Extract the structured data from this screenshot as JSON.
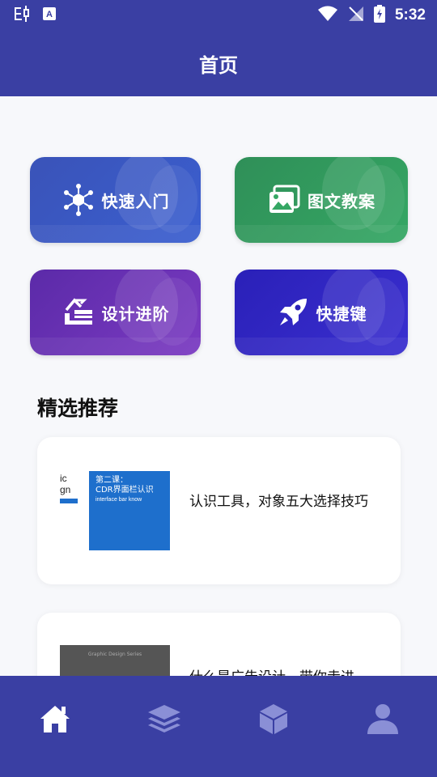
{
  "status_bar": {
    "time": "5:32",
    "icons": [
      "bug-app-icon",
      "a-translate-icon",
      "wifi-icon",
      "no-signal-icon",
      "battery-charging-icon"
    ]
  },
  "header": {
    "title": "首页"
  },
  "tiles": [
    {
      "label": "快速入门",
      "icon": "hexagon-network-icon",
      "color": "#3a53b8"
    },
    {
      "label": "图文教案",
      "icon": "images-icon",
      "color": "#2f8f58"
    },
    {
      "label": "设计进阶",
      "icon": "stairs-up-icon",
      "color": "#5b2aa8"
    },
    {
      "label": "快捷键",
      "icon": "rocket-icon",
      "color": "#2a20b8"
    }
  ],
  "section": {
    "title": "精选推荐"
  },
  "cards": [
    {
      "title": "认识工具，对象五大选择技巧",
      "thumb": {
        "left_lines": [
          "ic",
          "gn"
        ],
        "heading": "第二课：",
        "heading2": "CDR界面栏认识",
        "subtitle": "interface bar know"
      }
    },
    {
      "title": "什么是广告设计，带你走进",
      "thumb": {
        "caption": "Graphic Design Series"
      }
    }
  ],
  "bottom_nav": {
    "items": [
      {
        "name": "home",
        "icon": "home-icon",
        "active": true
      },
      {
        "name": "layers",
        "icon": "layers-icon",
        "active": false
      },
      {
        "name": "cube",
        "icon": "cube-icon",
        "active": false
      },
      {
        "name": "profile",
        "icon": "user-icon",
        "active": false
      }
    ]
  }
}
